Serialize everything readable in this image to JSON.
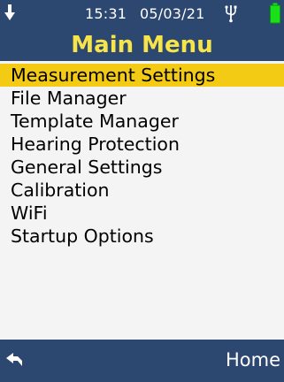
{
  "status_bar": {
    "time": "15:31",
    "date": "05/03/21",
    "icons": [
      "download-arrow-icon",
      "usb-icon",
      "battery-icon"
    ]
  },
  "header": {
    "title": "Main Menu"
  },
  "menu": {
    "items": [
      {
        "label": "Measurement Settings",
        "selected": true
      },
      {
        "label": "File Manager"
      },
      {
        "label": "Template Manager"
      },
      {
        "label": "Hearing Protection"
      },
      {
        "label": "General Settings"
      },
      {
        "label": "Calibration"
      },
      {
        "label": "WiFi"
      },
      {
        "label": "Startup Options"
      }
    ]
  },
  "footer": {
    "back_icon": "back-arrow-icon",
    "home_label": "Home"
  },
  "colors": {
    "header_bg": "#2d4870",
    "title_color": "#f6e54a",
    "selection_bg": "#f4cb14",
    "battery_color": "#19e019",
    "background": "#f4f4f4"
  }
}
